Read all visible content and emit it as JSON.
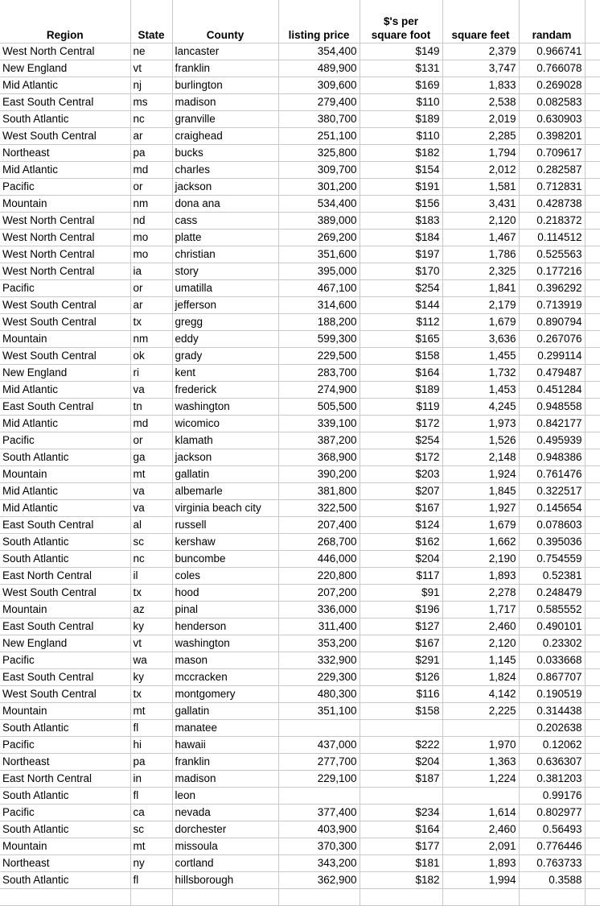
{
  "table": {
    "columns": [
      {
        "key": "region",
        "label": "Region",
        "align": "left"
      },
      {
        "key": "state",
        "label": "State",
        "align": "left"
      },
      {
        "key": "county",
        "label": "County",
        "align": "left"
      },
      {
        "key": "listing_price",
        "label": "listing price",
        "align": "right"
      },
      {
        "key": "per_square_foot",
        "label": "$'s per\nsquare foot",
        "label_line1": "$'s per",
        "label_line2": "square foot",
        "align": "right"
      },
      {
        "key": "square_feet",
        "label": "square feet",
        "align": "right"
      },
      {
        "key": "randam",
        "label": "randam",
        "align": "right"
      }
    ],
    "rows": [
      {
        "region": "West North Central",
        "state": "ne",
        "county": "lancaster",
        "listing_price": "354,400",
        "per_square_foot": "$149",
        "square_feet": "2,379",
        "randam": "0.966741"
      },
      {
        "region": "New England",
        "state": "vt",
        "county": "franklin",
        "listing_price": "489,900",
        "per_square_foot": "$131",
        "square_feet": "3,747",
        "randam": "0.766078"
      },
      {
        "region": "Mid Atlantic",
        "state": "nj",
        "county": "burlington",
        "listing_price": "309,600",
        "per_square_foot": "$169",
        "square_feet": "1,833",
        "randam": "0.269028"
      },
      {
        "region": "East South Central",
        "state": "ms",
        "county": "madison",
        "listing_price": "279,400",
        "per_square_foot": "$110",
        "square_feet": "2,538",
        "randam": "0.082583"
      },
      {
        "region": "South Atlantic",
        "state": "nc",
        "county": "granville",
        "listing_price": "380,700",
        "per_square_foot": "$189",
        "square_feet": "2,019",
        "randam": "0.630903"
      },
      {
        "region": "West South Central",
        "state": "ar",
        "county": "craighead",
        "listing_price": "251,100",
        "per_square_foot": "$110",
        "square_feet": "2,285",
        "randam": "0.398201"
      },
      {
        "region": "Northeast",
        "state": "pa",
        "county": "bucks",
        "listing_price": "325,800",
        "per_square_foot": "$182",
        "square_feet": "1,794",
        "randam": "0.709617"
      },
      {
        "region": "Mid Atlantic",
        "state": "md",
        "county": "charles",
        "listing_price": "309,700",
        "per_square_foot": "$154",
        "square_feet": "2,012",
        "randam": "0.282587"
      },
      {
        "region": "Pacific",
        "state": "or",
        "county": "jackson",
        "listing_price": "301,200",
        "per_square_foot": "$191",
        "square_feet": "1,581",
        "randam": "0.712831"
      },
      {
        "region": "Mountain",
        "state": "nm",
        "county": "dona ana",
        "listing_price": "534,400",
        "per_square_foot": "$156",
        "square_feet": "3,431",
        "randam": "0.428738"
      },
      {
        "region": "West North Central",
        "state": "nd",
        "county": "cass",
        "listing_price": "389,000",
        "per_square_foot": "$183",
        "square_feet": "2,120",
        "randam": "0.218372"
      },
      {
        "region": "West North Central",
        "state": "mo",
        "county": "platte",
        "listing_price": "269,200",
        "per_square_foot": "$184",
        "square_feet": "1,467",
        "randam": "0.114512"
      },
      {
        "region": "West North Central",
        "state": "mo",
        "county": "christian",
        "listing_price": "351,600",
        "per_square_foot": "$197",
        "square_feet": "1,786",
        "randam": "0.525563"
      },
      {
        "region": "West North Central",
        "state": "ia",
        "county": "story",
        "listing_price": "395,000",
        "per_square_foot": "$170",
        "square_feet": "2,325",
        "randam": "0.177216"
      },
      {
        "region": "Pacific",
        "state": "or",
        "county": "umatilla",
        "listing_price": "467,100",
        "per_square_foot": "$254",
        "square_feet": "1,841",
        "randam": "0.396292"
      },
      {
        "region": "West South Central",
        "state": "ar",
        "county": "jefferson",
        "listing_price": "314,600",
        "per_square_foot": "$144",
        "square_feet": "2,179",
        "randam": "0.713919"
      },
      {
        "region": "West South Central",
        "state": "tx",
        "county": "gregg",
        "listing_price": "188,200",
        "per_square_foot": "$112",
        "square_feet": "1,679",
        "randam": "0.890794"
      },
      {
        "region": "Mountain",
        "state": "nm",
        "county": "eddy",
        "listing_price": "599,300",
        "per_square_foot": "$165",
        "square_feet": "3,636",
        "randam": "0.267076"
      },
      {
        "region": "West South Central",
        "state": "ok",
        "county": "grady",
        "listing_price": "229,500",
        "per_square_foot": "$158",
        "square_feet": "1,455",
        "randam": "0.299114"
      },
      {
        "region": "New England",
        "state": "ri",
        "county": "kent",
        "listing_price": "283,700",
        "per_square_foot": "$164",
        "square_feet": "1,732",
        "randam": "0.479487"
      },
      {
        "region": "Mid Atlantic",
        "state": "va",
        "county": "frederick",
        "listing_price": "274,900",
        "per_square_foot": "$189",
        "square_feet": "1,453",
        "randam": "0.451284"
      },
      {
        "region": "East South Central",
        "state": "tn",
        "county": "washington",
        "listing_price": "505,500",
        "per_square_foot": "$119",
        "square_feet": "4,245",
        "randam": "0.948558"
      },
      {
        "region": "Mid Atlantic",
        "state": "md",
        "county": "wicomico",
        "listing_price": "339,100",
        "per_square_foot": "$172",
        "square_feet": "1,973",
        "randam": "0.842177"
      },
      {
        "region": "Pacific",
        "state": "or",
        "county": "klamath",
        "listing_price": "387,200",
        "per_square_foot": "$254",
        "square_feet": "1,526",
        "randam": "0.495939"
      },
      {
        "region": "South Atlantic",
        "state": "ga",
        "county": "jackson",
        "listing_price": "368,900",
        "per_square_foot": "$172",
        "square_feet": "2,148",
        "randam": "0.948386"
      },
      {
        "region": "Mountain",
        "state": "mt",
        "county": "gallatin",
        "listing_price": "390,200",
        "per_square_foot": "$203",
        "square_feet": "1,924",
        "randam": "0.761476"
      },
      {
        "region": "Mid Atlantic",
        "state": "va",
        "county": "albemarle",
        "listing_price": "381,800",
        "per_square_foot": "$207",
        "square_feet": "1,845",
        "randam": "0.322517"
      },
      {
        "region": "Mid Atlantic",
        "state": "va",
        "county": "virginia beach city",
        "listing_price": "322,500",
        "per_square_foot": "$167",
        "square_feet": "1,927",
        "randam": "0.145654"
      },
      {
        "region": "East South Central",
        "state": "al",
        "county": "russell",
        "listing_price": "207,400",
        "per_square_foot": "$124",
        "square_feet": "1,679",
        "randam": "0.078603"
      },
      {
        "region": "South Atlantic",
        "state": "sc",
        "county": "kershaw",
        "listing_price": "268,700",
        "per_square_foot": "$162",
        "square_feet": "1,662",
        "randam": "0.395036"
      },
      {
        "region": "South Atlantic",
        "state": "nc",
        "county": "buncombe",
        "listing_price": "446,000",
        "per_square_foot": "$204",
        "square_feet": "2,190",
        "randam": "0.754559"
      },
      {
        "region": "East North Central",
        "state": "il",
        "county": "coles",
        "listing_price": "220,800",
        "per_square_foot": "$117",
        "square_feet": "1,893",
        "randam": "0.52381"
      },
      {
        "region": "West South Central",
        "state": "tx",
        "county": "hood",
        "listing_price": "207,200",
        "per_square_foot": "$91",
        "square_feet": "2,278",
        "randam": "0.248479"
      },
      {
        "region": "Mountain",
        "state": "az",
        "county": "pinal",
        "listing_price": "336,000",
        "per_square_foot": "$196",
        "square_feet": "1,717",
        "randam": "0.585552"
      },
      {
        "region": "East South Central",
        "state": "ky",
        "county": "henderson",
        "listing_price": "311,400",
        "per_square_foot": "$127",
        "square_feet": "2,460",
        "randam": "0.490101"
      },
      {
        "region": "New England",
        "state": "vt",
        "county": "washington",
        "listing_price": "353,200",
        "per_square_foot": "$167",
        "square_feet": "2,120",
        "randam": "0.23302"
      },
      {
        "region": "Pacific",
        "state": "wa",
        "county": "mason",
        "listing_price": "332,900",
        "per_square_foot": "$291",
        "square_feet": "1,145",
        "randam": "0.033668"
      },
      {
        "region": "East South Central",
        "state": "ky",
        "county": "mccracken",
        "listing_price": "229,300",
        "per_square_foot": "$126",
        "square_feet": "1,824",
        "randam": "0.867707"
      },
      {
        "region": "West South Central",
        "state": "tx",
        "county": "montgomery",
        "listing_price": "480,300",
        "per_square_foot": "$116",
        "square_feet": "4,142",
        "randam": "0.190519"
      },
      {
        "region": "Mountain",
        "state": "mt",
        "county": "gallatin",
        "listing_price": "351,100",
        "per_square_foot": "$158",
        "square_feet": "2,225",
        "randam": "0.314438"
      },
      {
        "region": "South Atlantic",
        "state": "fl",
        "county": "manatee",
        "listing_price": "",
        "per_square_foot": "",
        "square_feet": "",
        "randam": "0.202638"
      },
      {
        "region": "Pacific",
        "state": "hi",
        "county": "hawaii",
        "listing_price": "437,000",
        "per_square_foot": "$222",
        "square_feet": "1,970",
        "randam": "0.12062"
      },
      {
        "region": "Northeast",
        "state": "pa",
        "county": "franklin",
        "listing_price": "277,700",
        "per_square_foot": "$204",
        "square_feet": "1,363",
        "randam": "0.636307"
      },
      {
        "region": "East North Central",
        "state": "in",
        "county": "madison",
        "listing_price": "229,100",
        "per_square_foot": "$187",
        "square_feet": "1,224",
        "randam": "0.381203"
      },
      {
        "region": "South Atlantic",
        "state": "fl",
        "county": "leon",
        "listing_price": "",
        "per_square_foot": "",
        "square_feet": "",
        "randam": "0.99176"
      },
      {
        "region": "Pacific",
        "state": "ca",
        "county": "nevada",
        "listing_price": "377,400",
        "per_square_foot": "$234",
        "square_feet": "1,614",
        "randam": "0.802977"
      },
      {
        "region": "South Atlantic",
        "state": "sc",
        "county": "dorchester",
        "listing_price": "403,900",
        "per_square_foot": "$164",
        "square_feet": "2,460",
        "randam": "0.56493"
      },
      {
        "region": "Mountain",
        "state": "mt",
        "county": "missoula",
        "listing_price": "370,300",
        "per_square_foot": "$177",
        "square_feet": "2,091",
        "randam": "0.776446"
      },
      {
        "region": "Northeast",
        "state": "ny",
        "county": "cortland",
        "listing_price": "343,200",
        "per_square_foot": "$181",
        "square_feet": "1,893",
        "randam": "0.763733"
      },
      {
        "region": "South Atlantic",
        "state": "fl",
        "county": "hillsborough",
        "listing_price": "362,900",
        "per_square_foot": "$182",
        "square_feet": "1,994",
        "randam": "0.3588"
      },
      {
        "region": "",
        "state": "",
        "county": "",
        "listing_price": "",
        "per_square_foot": "",
        "square_feet": "",
        "randam": ""
      }
    ]
  },
  "style": {
    "gridline_color": "#c9c9c9",
    "text_color": "#000000",
    "background": "#ffffff"
  }
}
